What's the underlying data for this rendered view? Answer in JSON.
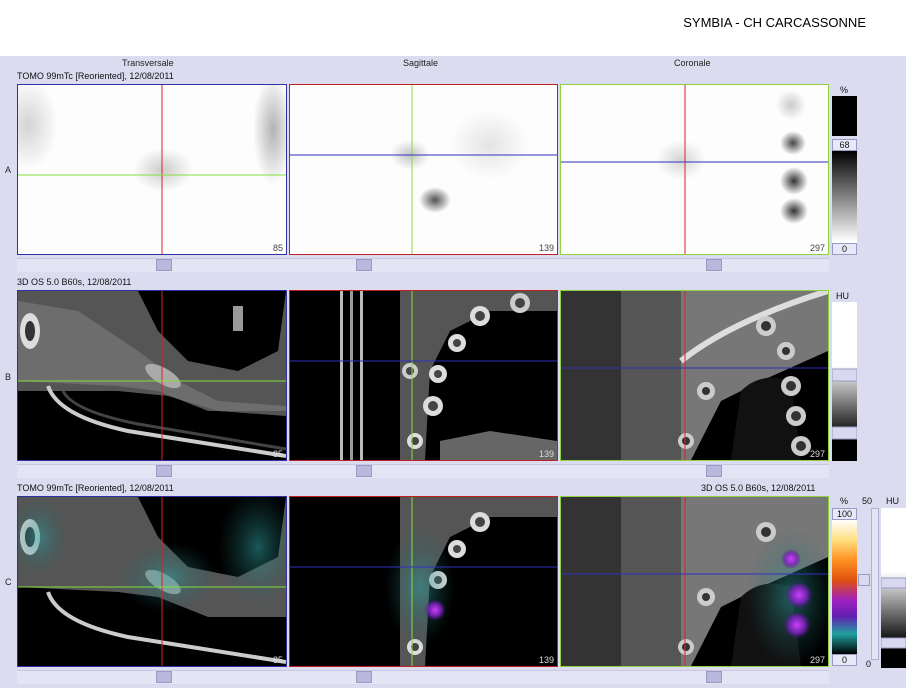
{
  "header": {
    "title": "SYMBIA - CH CARCASSONNE"
  },
  "columns": {
    "transverse": "Transversale",
    "sagittal": "Sagittale",
    "coronal": "Coronale"
  },
  "rows": {
    "a": {
      "label": "A",
      "series": "TOMO 99mTc [Reoriented], 12/08/2011"
    },
    "b": {
      "label": "B",
      "series": "3D  OS  5.0  B60s, 12/08/2011"
    },
    "c": {
      "label": "C",
      "series_left": "TOMO 99mTc [Reoriented], 12/08/2011",
      "series_right": "3D  OS  5.0  B60s, 12/08/2011"
    }
  },
  "slices": {
    "transverse": "85",
    "sagittal": "139",
    "coronal": "297"
  },
  "scales": {
    "a": {
      "unit": "%",
      "level": "68",
      "min": "0"
    },
    "b": {
      "unit": "HU"
    },
    "c": {
      "unit_pct": "%",
      "max": "100",
      "min": "0",
      "window": "50",
      "unit_hu": "HU",
      "hu_min": "0"
    }
  },
  "colors": {
    "transverse_border": "#3030a0",
    "sagittal_border": "#c02020",
    "coronal_border": "#90d040",
    "crosshair_red": "#e02020",
    "crosshair_green": "#80e040",
    "crosshair_blue": "#3030c0"
  }
}
